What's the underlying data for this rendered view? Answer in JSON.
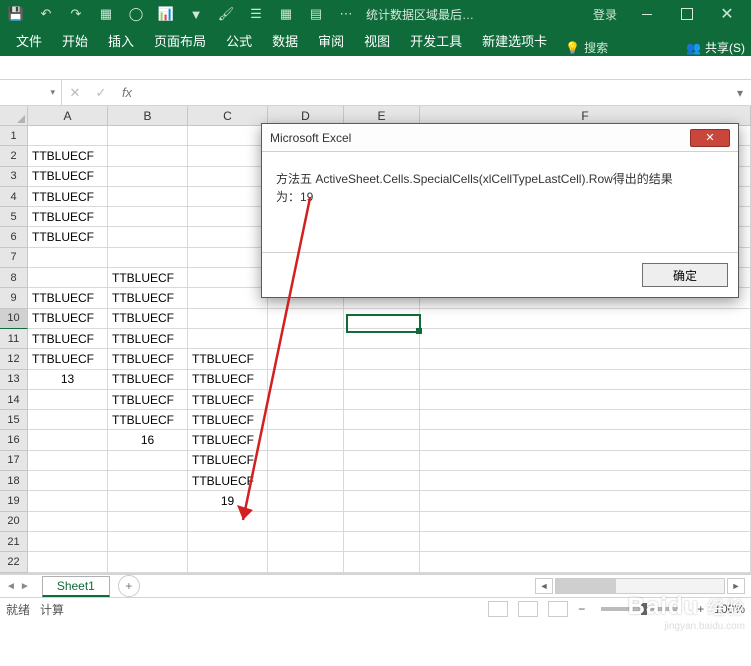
{
  "titlebar": {
    "title": "统计数据区域最后…",
    "login": "登录"
  },
  "window_controls": {
    "close_glyph": "✕"
  },
  "qat_icons": [
    "save-icon",
    "undo-icon",
    "redo-icon",
    "table-icon",
    "circle-icon",
    "chart-icon",
    "filter-icon",
    "format-icon",
    "view-icon",
    "border-icon",
    "freeze-icon",
    "more-icon"
  ],
  "ribbon": {
    "tabs": [
      "文件",
      "开始",
      "插入",
      "页面布局",
      "公式",
      "数据",
      "审阅",
      "视图",
      "开发工具",
      "新建选项卡"
    ],
    "search_hint": "搜索",
    "share": "共享(S)"
  },
  "namebox": {
    "value": ""
  },
  "formula": {
    "value": ""
  },
  "fx_label": "fx",
  "columns": [
    "A",
    "B",
    "C",
    "D",
    "E",
    "F"
  ],
  "rows": [
    1,
    2,
    3,
    4,
    5,
    6,
    7,
    8,
    9,
    10,
    11,
    12,
    13,
    14,
    15,
    16,
    17,
    18,
    19,
    20,
    21,
    22
  ],
  "active_row": 10,
  "cells": {
    "r2": {
      "A": "TTBLUECF"
    },
    "r3": {
      "A": "TTBLUECF"
    },
    "r4": {
      "A": "TTBLUECF"
    },
    "r5": {
      "A": "TTBLUECF"
    },
    "r6": {
      "A": "TTBLUECF"
    },
    "r8": {
      "B": "TTBLUECF"
    },
    "r9": {
      "A": "TTBLUECF",
      "B": "TTBLUECF"
    },
    "r10": {
      "A": "TTBLUECF",
      "B": "TTBLUECF"
    },
    "r11": {
      "A": "TTBLUECF",
      "B": "TTBLUECF"
    },
    "r12": {
      "A": "TTBLUECF",
      "B": "TTBLUECF",
      "C": "TTBLUECF"
    },
    "r13": {
      "A": "13",
      "B": "TTBLUECF",
      "C": "TTBLUECF"
    },
    "r14": {
      "B": "TTBLUECF",
      "C": "TTBLUECF"
    },
    "r15": {
      "B": "TTBLUECF",
      "C": "TTBLUECF"
    },
    "r16": {
      "B": "16",
      "C": "TTBLUECF"
    },
    "r17": {
      "C": "TTBLUECF"
    },
    "r18": {
      "C": "TTBLUECF"
    },
    "r19": {
      "C": "19"
    }
  },
  "sheet": {
    "name": "Sheet1"
  },
  "status": {
    "left1": "就绪",
    "left2": "计算",
    "zoom": "100%"
  },
  "dialog": {
    "title": "Microsoft Excel",
    "body_line1": "方法五  ActiveSheet.Cells.SpecialCells(xlCellTypeLastCell).Row得出的结果",
    "body_line2": "为：19",
    "ok": "确定"
  },
  "watermark": {
    "brand_main": "Baidu",
    "brand_sub": "经验",
    "url": "jingyan.baidu.com"
  },
  "glyphs": {
    "bulb": "💡",
    "people": "👥",
    "nav_left": "◄",
    "nav_right": "►",
    "plus": "+",
    "minus": "−",
    "caret": "▾",
    "check": "✓",
    "cross": "✕"
  }
}
